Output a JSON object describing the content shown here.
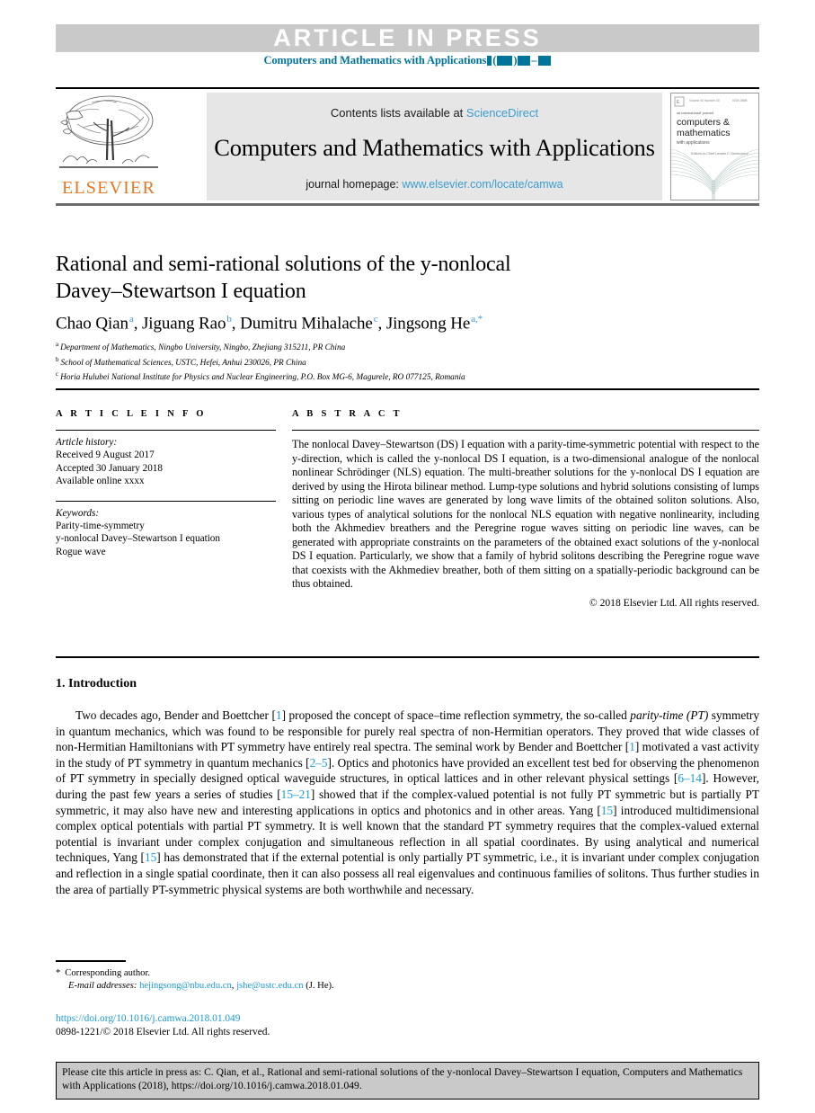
{
  "banner": {
    "article_in_press": "ARTICLE  IN  PRESS",
    "journal_ref_prefix": "Computers and Mathematics with Applications"
  },
  "masthead": {
    "contents_prefix": "Contents lists available at ",
    "sciencedirect": "ScienceDirect",
    "journal_title": "Computers and Mathematics with Applications",
    "homepage_prefix": "journal homepage: ",
    "homepage_url": "www.elsevier.com/locate/camwa",
    "publisher_logo_text": "ELSEVIER",
    "publisher_logo_color": "#e87722",
    "cover_title_line1": "computers &",
    "cover_title_line2": "mathematics",
    "cover_title_line3": "with applications",
    "cover_kicker": "an international journal",
    "cover_editors": "Editors-in-Chief  Leszek F. Demkowicz"
  },
  "article": {
    "title": "Rational and semi-rational solutions of the y-nonlocal Davey–Stewartson I equation",
    "title_line1": "Rational and semi-rational solutions of the y-nonlocal",
    "title_line2": "Davey–Stewartson I equation",
    "authors": [
      {
        "name": "Chao Qian",
        "sup": "a"
      },
      {
        "name": "Jiguang Rao",
        "sup": "b"
      },
      {
        "name": "Dumitru Mihalache",
        "sup": "c"
      },
      {
        "name": "Jingsong He",
        "sup": "a,*"
      }
    ],
    "affiliations": [
      {
        "marker": "a",
        "text": "Department of Mathematics, Ningbo University, Ningbo, Zhejiang 315211, PR China"
      },
      {
        "marker": "b",
        "text": "School of Mathematical Sciences, USTC, Hefei, Anhui 230026, PR China"
      },
      {
        "marker": "c",
        "text": "Horia Hulubei National Institute for Physics and Nuclear Engineering, P.O. Box MG-6, Magurele, RO 077125, Romania"
      }
    ]
  },
  "article_info": {
    "heading": "A R T I C L E   I N F O",
    "history_label": "Article history:",
    "received": "Received 9 August 2017",
    "accepted": "Accepted 30 January 2018",
    "available_online": "Available online xxxx",
    "keywords_label": "Keywords:",
    "keywords": [
      "Parity-time-symmetry",
      "y-nonlocal Davey–Stewartson I equation",
      "Rogue wave"
    ]
  },
  "abstract": {
    "heading": "A B S T R A C T",
    "text": "The nonlocal Davey–Stewartson (DS) I equation with a parity-time-symmetric potential with respect to the y-direction, which is called the y-nonlocal DS I equation, is a two-dimensional analogue of the nonlocal nonlinear Schrödinger (NLS) equation. The multi-breather solutions for the y-nonlocal DS I equation are derived by using the Hirota bilinear method. Lump-type solutions and hybrid solutions consisting of lumps sitting on periodic line waves are generated by long wave limits of the obtained soliton solutions. Also, various types of analytical solutions for the nonlocal NLS equation with negative nonlinearity, including both the Akhmediev breathers and the Peregrine rogue waves sitting on periodic line waves, can be generated with appropriate constraints on the parameters of the obtained exact solutions of the y-nonlocal DS I equation. Particularly, we show that a family of hybrid solitons describing the Peregrine rogue wave that coexists with the Akhmediev breather, both of them sitting on a spatially-periodic background can be thus obtained.",
    "copyright": "© 2018 Elsevier Ltd. All rights reserved."
  },
  "introduction": {
    "heading": "1.  Introduction",
    "paragraph1_part1": "Two decades ago, Bender and Boettcher [",
    "ref1": "1",
    "paragraph1_part2": "] proposed the concept of space–time reflection symmetry, the so-called ",
    "italic1": "parity-time (PT)",
    "paragraph1_part3": " symmetry in quantum mechanics, which was found to be responsible for purely real spectra of non-Hermitian operators. They proved that wide classes of non-Hermitian Hamiltonians with PT symmetry have entirely real spectra. The seminal work by Bender and Boettcher [",
    "ref2": "1",
    "paragraph1_part4": "] motivated a vast activity in the study of PT symmetry in quantum mechanics [",
    "ref3": "2–5",
    "paragraph1_part5": "]. Optics and photonics have provided an excellent test bed for observing the phenomenon of PT symmetry in specially designed optical waveguide structures, in optical lattices and in other relevant physical settings [",
    "ref4": "6–14",
    "paragraph1_part6": "]. However, during the past few years a series of studies [",
    "ref5": "15–21",
    "paragraph1_part7": "] showed that if the complex-valued potential is not fully PT symmetric but is partially PT symmetric, it may also have new and interesting applications in optics and photonics and in other areas. Yang [",
    "ref6": "15",
    "paragraph1_part8": "] introduced multidimensional complex optical potentials with partial PT symmetry. It is well known that the standard PT symmetry requires that the complex-valued external potential is invariant under complex conjugation and simultaneous reflection in all spatial coordinates. By using analytical and numerical techniques, Yang [",
    "ref7": "15",
    "paragraph1_part9": "] has demonstrated that if the external potential is only partially PT symmetric, i.e., it is invariant under complex conjugation and reflection in a single spatial coordinate, then it can also possess all real eigenvalues and continuous families of solitons. Thus further studies in the area of partially PT-symmetric physical systems are both worthwhile and necessary."
  },
  "footnotes": {
    "corresponding_marker": "*",
    "corresponding_label": "Corresponding author.",
    "email_label": "E-mail addresses:",
    "email1": "hejingsong@nbu.edu.cn",
    "email2": "jshe@ustc.edu.cn",
    "email_suffix": "(J. He).",
    "doi": "https://doi.org/10.1016/j.camwa.2018.01.049",
    "issn_line": "0898-1221/© 2018 Elsevier Ltd. All rights reserved."
  },
  "cite_box": {
    "text": "Please cite this article in press as: C. Qian, et al., Rational and semi-rational solutions of the y-nonlocal Davey–Stewartson I equation, Computers and Mathematics with Applications (2018), https://doi.org/10.1016/j.camwa.2018.01.049."
  },
  "colors": {
    "link_blue": "#3b9dd2",
    "ref_blue": "#1a9bd7",
    "banner_gray": "#c9c9c9",
    "panel_gray": "#e6e6e6",
    "elsevier_orange": "#e87722",
    "journal_blue": "#00749b"
  }
}
